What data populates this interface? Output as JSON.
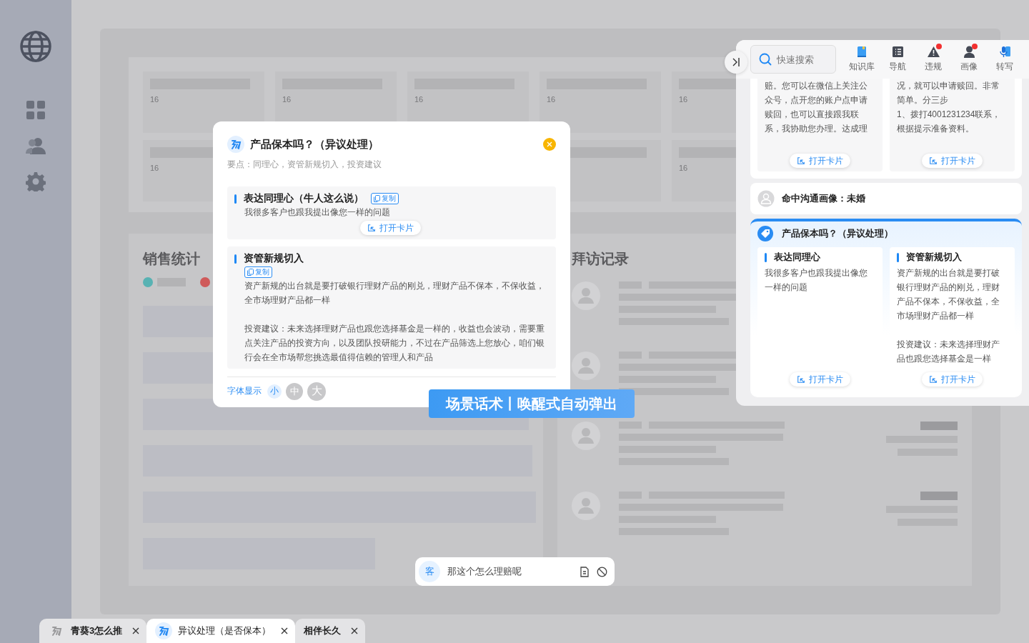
{
  "dashboard": {
    "stat_cards": [
      {
        "kind": "value",
        "value": "16"
      },
      {
        "kind": "value",
        "value": "16"
      },
      {
        "kind": "value",
        "value": "16"
      },
      {
        "kind": "value",
        "value": "16"
      },
      {
        "kind": "value",
        "value": "16"
      },
      {
        "kind": "value",
        "value": "16"
      },
      {
        "kind": "covered"
      },
      {
        "kind": "covered"
      },
      {
        "kind": "blank"
      },
      {
        "kind": "value",
        "value": "16"
      }
    ],
    "sales_stats": {
      "title": "销售统计",
      "legend": [
        {
          "color": "#58b2b3"
        },
        {
          "color": "#cf5a5a"
        }
      ]
    },
    "visit_records": {
      "title": "拜访记录"
    }
  },
  "modal": {
    "title": "产品保本吗？（异议处理）",
    "subtitle": "要点：同理心，资管新规切入，投资建议",
    "blocks": [
      {
        "kind": "inline",
        "title": "表达同理心（牛人这么说）",
        "copy": "复制",
        "paragraphs": [
          "我很多客户也跟我提出像您一样的问题"
        ],
        "open": "打开卡片"
      },
      {
        "kind": "stacked",
        "title": "资管新规切入",
        "copy": "复制",
        "paragraphs": [
          "资产新规的出台就是要打破银行理财产品的刚兑，理财产品不保本，不保收益，全市场理财产品都一样",
          "投资建议：未来选择理财产品也跟您选择基金是一样的，收益也会波动，需要重点关注产品的投资方向，以及团队投研能力，不过在产品筛选上您放心，咱们银行会在全市场帮您挑选最值得信赖的管理人和产品"
        ]
      }
    ],
    "font_label": "字体显示",
    "font_sizes": [
      {
        "label": "小",
        "selected": true
      },
      {
        "label": "中",
        "selected": false
      },
      {
        "label": "大",
        "selected": false
      }
    ]
  },
  "banner": {
    "text": "场景话术丨唤醒式自动弹出"
  },
  "assistant_panel": {
    "search": {
      "placeholder": "快速搜索"
    },
    "tools": [
      {
        "kind": "knowledge",
        "label": "知识库",
        "badge": false
      },
      {
        "kind": "navigation",
        "label": "导航",
        "badge": false
      },
      {
        "kind": "violation",
        "label": "违规",
        "badge": true
      },
      {
        "kind": "profile",
        "label": "画像",
        "badge": true
      },
      {
        "kind": "transcribe",
        "label": "转写",
        "badge": false
      }
    ],
    "previous_card": {
      "columns": [
        {
          "paragraphs": [
            "赔。您可以在微信上关注公众号，点开您的账户点申请赎回，也可以直接跟我联系，我协助您办理。达成理"
          ],
          "open": "打开卡片"
        },
        {
          "paragraphs": [
            "况，就可以申请赎回。非常简单。分三步",
            "1、拨打4001231234联系，根据提示准备资料。"
          ],
          "open": "打开卡片"
        }
      ]
    },
    "profile_hit": "命中沟通画像：未婚",
    "active_card": {
      "title": "产品保本吗？（异议处理）",
      "columns": [
        {
          "heading": "表达同理心",
          "paragraphs": [
            "我很多客户也跟我提出像您一样的问题"
          ],
          "open": "打开卡片"
        },
        {
          "heading": "资管新规切入",
          "paragraphs": [
            "资产新规的出台就是要打破银行理财产品的刚兑，理财产品不保本，不保收益，全市场理财产品都一样",
            "投资建议：未来选择理财产品也跟您选择基金是一样"
          ],
          "open": "打开卡片"
        }
      ]
    }
  },
  "chat": {
    "avatar": "客",
    "text": "那这个怎么理赔呢"
  },
  "tabs": [
    {
      "kind": "case",
      "label": "青葵3怎么推",
      "selected": false
    },
    {
      "kind": "scene",
      "label": "异议处理（是否保本）",
      "selected": true
    },
    {
      "kind": "plain",
      "label": "相伴长久",
      "selected": false
    }
  ]
}
